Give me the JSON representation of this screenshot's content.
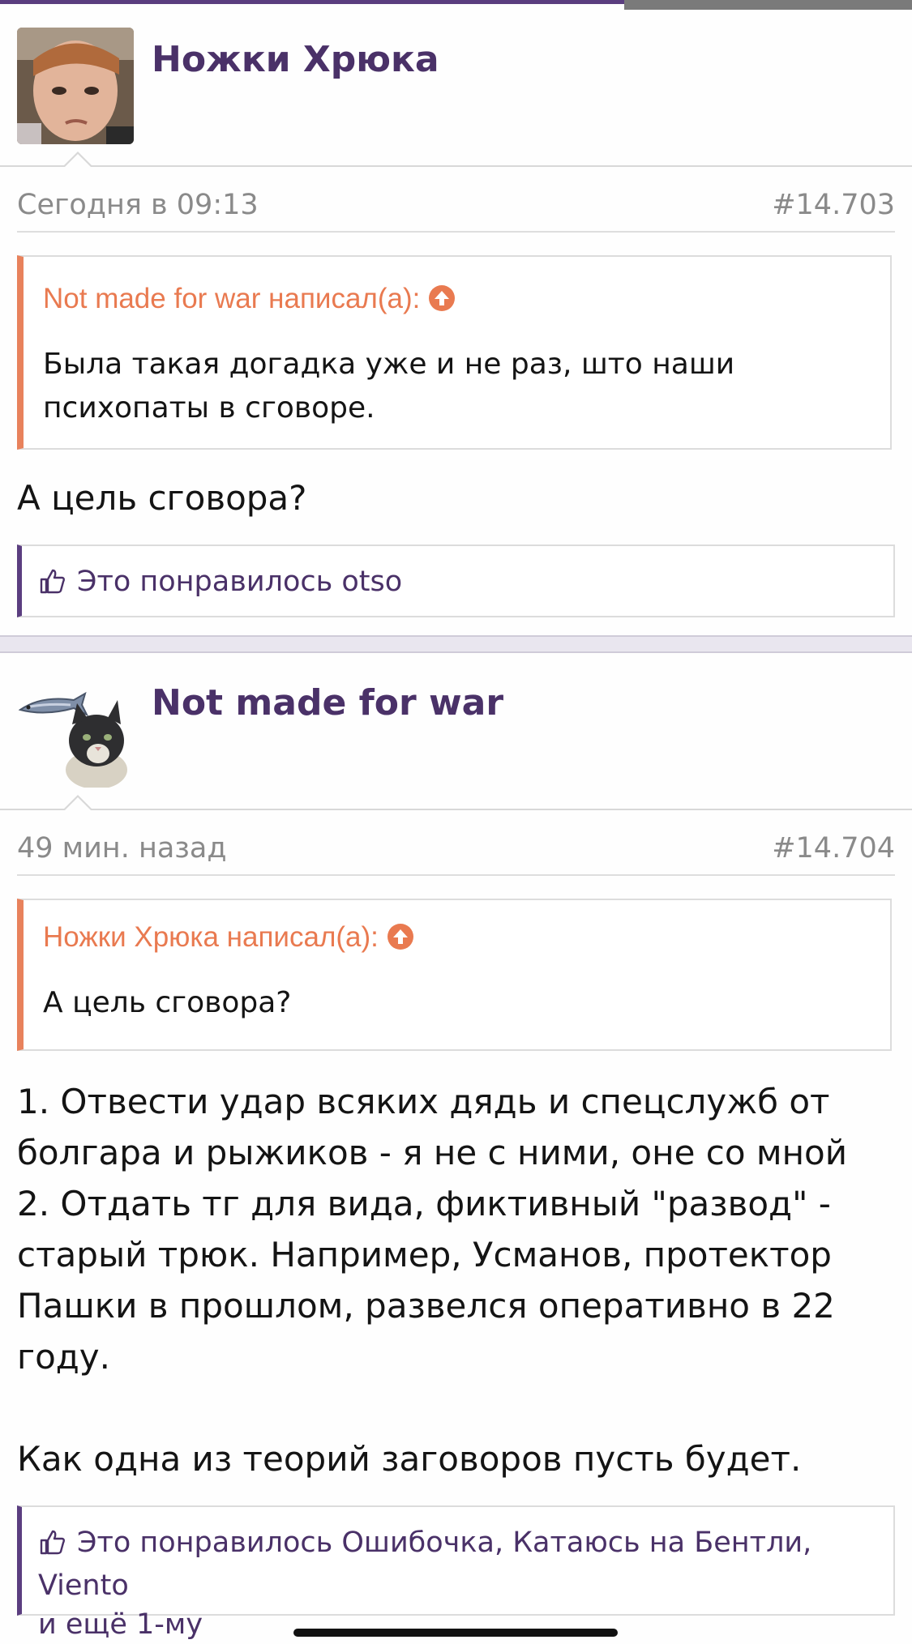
{
  "posts": [
    {
      "author": "Ножки Хрюка",
      "date": "Сегодня в 09:13",
      "number": "#14.703",
      "quote": {
        "header": "Not made for war написал(а):",
        "text": "Была такая догадка уже и не раз, што наши психопаты в сговоре."
      },
      "body": "А цель сговора?",
      "likes": "Это понравилось otso",
      "avatar_icon": "avatar-photo-child-icon"
    },
    {
      "author": "Not made for war",
      "date": "49 мин. назад",
      "number": "#14.704",
      "quote": {
        "header": "Ножки Хрюка написал(а):",
        "text": "А цель сговора?"
      },
      "body_lines": [
        "1. Отвести удар всяких дядь и спецслужб от",
        "болгара и рыжиков - я не с ними, оне со мной",
        "2. Отдать тг для вида, фиктивный \"развод\" -",
        "старый трюк. Например, Усманов, протектор",
        "Пашки в прошлом, развелся оперативно в 22",
        "году.",
        "",
        "Как одна из теорий заговоров пусть будет."
      ],
      "likes_line1": "Это понравилось Ошибочка, Катаюсь на Бентли, Viento",
      "likes_line2": "и ещё 1-му",
      "avatar_icon": "avatar-cat-fish-icon"
    }
  ],
  "colors": {
    "accent": "#4a3168",
    "quote_accent": "#e8825c",
    "meta_text": "#8a8a8a"
  }
}
